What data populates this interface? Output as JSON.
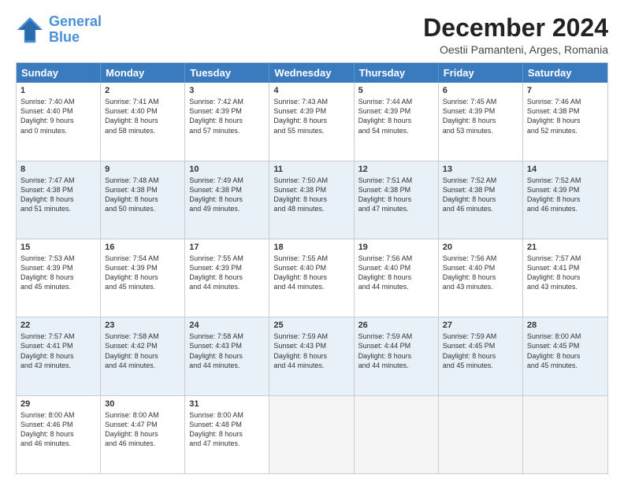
{
  "logo": {
    "line1": "General",
    "line2": "Blue"
  },
  "title": "December 2024",
  "subtitle": "Oestii Pamanteni, Arges, Romania",
  "header_days": [
    "Sunday",
    "Monday",
    "Tuesday",
    "Wednesday",
    "Thursday",
    "Friday",
    "Saturday"
  ],
  "rows": [
    {
      "alt": false,
      "cells": [
        {
          "day": "1",
          "lines": [
            "Sunrise: 7:40 AM",
            "Sunset: 4:40 PM",
            "Daylight: 9 hours",
            "and 0 minutes."
          ]
        },
        {
          "day": "2",
          "lines": [
            "Sunrise: 7:41 AM",
            "Sunset: 4:40 PM",
            "Daylight: 8 hours",
            "and 58 minutes."
          ]
        },
        {
          "day": "3",
          "lines": [
            "Sunrise: 7:42 AM",
            "Sunset: 4:39 PM",
            "Daylight: 8 hours",
            "and 57 minutes."
          ]
        },
        {
          "day": "4",
          "lines": [
            "Sunrise: 7:43 AM",
            "Sunset: 4:39 PM",
            "Daylight: 8 hours",
            "and 55 minutes."
          ]
        },
        {
          "day": "5",
          "lines": [
            "Sunrise: 7:44 AM",
            "Sunset: 4:39 PM",
            "Daylight: 8 hours",
            "and 54 minutes."
          ]
        },
        {
          "day": "6",
          "lines": [
            "Sunrise: 7:45 AM",
            "Sunset: 4:39 PM",
            "Daylight: 8 hours",
            "and 53 minutes."
          ]
        },
        {
          "day": "7",
          "lines": [
            "Sunrise: 7:46 AM",
            "Sunset: 4:38 PM",
            "Daylight: 8 hours",
            "and 52 minutes."
          ]
        }
      ]
    },
    {
      "alt": true,
      "cells": [
        {
          "day": "8",
          "lines": [
            "Sunrise: 7:47 AM",
            "Sunset: 4:38 PM",
            "Daylight: 8 hours",
            "and 51 minutes."
          ]
        },
        {
          "day": "9",
          "lines": [
            "Sunrise: 7:48 AM",
            "Sunset: 4:38 PM",
            "Daylight: 8 hours",
            "and 50 minutes."
          ]
        },
        {
          "day": "10",
          "lines": [
            "Sunrise: 7:49 AM",
            "Sunset: 4:38 PM",
            "Daylight: 8 hours",
            "and 49 minutes."
          ]
        },
        {
          "day": "11",
          "lines": [
            "Sunrise: 7:50 AM",
            "Sunset: 4:38 PM",
            "Daylight: 8 hours",
            "and 48 minutes."
          ]
        },
        {
          "day": "12",
          "lines": [
            "Sunrise: 7:51 AM",
            "Sunset: 4:38 PM",
            "Daylight: 8 hours",
            "and 47 minutes."
          ]
        },
        {
          "day": "13",
          "lines": [
            "Sunrise: 7:52 AM",
            "Sunset: 4:38 PM",
            "Daylight: 8 hours",
            "and 46 minutes."
          ]
        },
        {
          "day": "14",
          "lines": [
            "Sunrise: 7:52 AM",
            "Sunset: 4:39 PM",
            "Daylight: 8 hours",
            "and 46 minutes."
          ]
        }
      ]
    },
    {
      "alt": false,
      "cells": [
        {
          "day": "15",
          "lines": [
            "Sunrise: 7:53 AM",
            "Sunset: 4:39 PM",
            "Daylight: 8 hours",
            "and 45 minutes."
          ]
        },
        {
          "day": "16",
          "lines": [
            "Sunrise: 7:54 AM",
            "Sunset: 4:39 PM",
            "Daylight: 8 hours",
            "and 45 minutes."
          ]
        },
        {
          "day": "17",
          "lines": [
            "Sunrise: 7:55 AM",
            "Sunset: 4:39 PM",
            "Daylight: 8 hours",
            "and 44 minutes."
          ]
        },
        {
          "day": "18",
          "lines": [
            "Sunrise: 7:55 AM",
            "Sunset: 4:40 PM",
            "Daylight: 8 hours",
            "and 44 minutes."
          ]
        },
        {
          "day": "19",
          "lines": [
            "Sunrise: 7:56 AM",
            "Sunset: 4:40 PM",
            "Daylight: 8 hours",
            "and 44 minutes."
          ]
        },
        {
          "day": "20",
          "lines": [
            "Sunrise: 7:56 AM",
            "Sunset: 4:40 PM",
            "Daylight: 8 hours",
            "and 43 minutes."
          ]
        },
        {
          "day": "21",
          "lines": [
            "Sunrise: 7:57 AM",
            "Sunset: 4:41 PM",
            "Daylight: 8 hours",
            "and 43 minutes."
          ]
        }
      ]
    },
    {
      "alt": true,
      "cells": [
        {
          "day": "22",
          "lines": [
            "Sunrise: 7:57 AM",
            "Sunset: 4:41 PM",
            "Daylight: 8 hours",
            "and 43 minutes."
          ]
        },
        {
          "day": "23",
          "lines": [
            "Sunrise: 7:58 AM",
            "Sunset: 4:42 PM",
            "Daylight: 8 hours",
            "and 44 minutes."
          ]
        },
        {
          "day": "24",
          "lines": [
            "Sunrise: 7:58 AM",
            "Sunset: 4:43 PM",
            "Daylight: 8 hours",
            "and 44 minutes."
          ]
        },
        {
          "day": "25",
          "lines": [
            "Sunrise: 7:59 AM",
            "Sunset: 4:43 PM",
            "Daylight: 8 hours",
            "and 44 minutes."
          ]
        },
        {
          "day": "26",
          "lines": [
            "Sunrise: 7:59 AM",
            "Sunset: 4:44 PM",
            "Daylight: 8 hours",
            "and 44 minutes."
          ]
        },
        {
          "day": "27",
          "lines": [
            "Sunrise: 7:59 AM",
            "Sunset: 4:45 PM",
            "Daylight: 8 hours",
            "and 45 minutes."
          ]
        },
        {
          "day": "28",
          "lines": [
            "Sunrise: 8:00 AM",
            "Sunset: 4:45 PM",
            "Daylight: 8 hours",
            "and 45 minutes."
          ]
        }
      ]
    },
    {
      "alt": false,
      "cells": [
        {
          "day": "29",
          "lines": [
            "Sunrise: 8:00 AM",
            "Sunset: 4:46 PM",
            "Daylight: 8 hours",
            "and 46 minutes."
          ]
        },
        {
          "day": "30",
          "lines": [
            "Sunrise: 8:00 AM",
            "Sunset: 4:47 PM",
            "Daylight: 8 hours",
            "and 46 minutes."
          ]
        },
        {
          "day": "31",
          "lines": [
            "Sunrise: 8:00 AM",
            "Sunset: 4:48 PM",
            "Daylight: 8 hours",
            "and 47 minutes."
          ]
        },
        {
          "day": "",
          "lines": []
        },
        {
          "day": "",
          "lines": []
        },
        {
          "day": "",
          "lines": []
        },
        {
          "day": "",
          "lines": []
        }
      ]
    }
  ]
}
